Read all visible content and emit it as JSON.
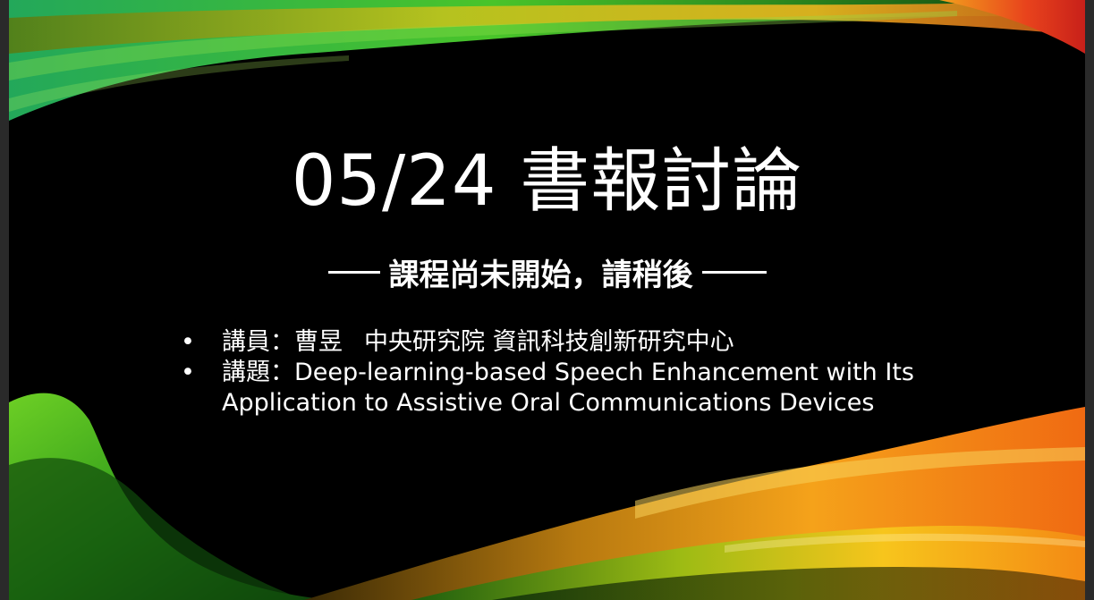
{
  "slide": {
    "title": "05/24 書報討論",
    "subtitle": "課程尚未開始，請稍後",
    "bullets": [
      {
        "marker": "•",
        "label": "講員：曹昱",
        "affiliation": "中央研究院 資訊科技創新研究中心"
      },
      {
        "marker": "•",
        "label": "講題：",
        "text": "Deep-learning-based Speech Enhancement with Its Application to Assistive Oral Communications Devices"
      }
    ]
  },
  "theme": {
    "background": "#000000",
    "text": "#ffffff",
    "accent_green": "#3fbf2a",
    "accent_orange": "#f5821f",
    "accent_yellow": "#f9c623"
  }
}
